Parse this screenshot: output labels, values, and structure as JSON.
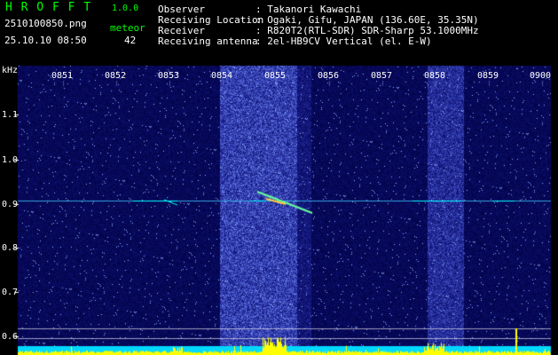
{
  "app": {
    "name": "H R O F F T",
    "version": "1.0.0",
    "filename": "2510100850.png",
    "datetime": "25.10.10 08:50",
    "meteor_label": "meteor",
    "meteor_count": "42"
  },
  "info": [
    {
      "key": "Observer",
      "value": ": Takanori Kawachi"
    },
    {
      "key": "Receiving Location",
      "value": ": Ogaki, Gifu, JAPAN (136.60E, 35.35N)"
    },
    {
      "key": "Receiver",
      "value": ": R820T2(RTL-SDR) SDR-Sharp 53.1000MHz"
    },
    {
      "key": "Receiving antenna",
      "value": ": 2el-HB9CV Vertical (el. E-W)"
    }
  ],
  "axis": {
    "y_unit": "kHz",
    "y_ticks": [
      "1.1",
      "1.0",
      "0.9",
      "0.8",
      "0.7",
      "0.6"
    ],
    "x_ticks": [
      "0851",
      "0852",
      "0853",
      "0854",
      "0855",
      "0856",
      "0857",
      "0858",
      "0859",
      "0900"
    ]
  },
  "colors": {
    "background": "#000000",
    "noise_dark": "#00007a",
    "noise_bright": "#3b5cff",
    "signal": "#00ffff",
    "header_green": "#00ff00"
  }
}
